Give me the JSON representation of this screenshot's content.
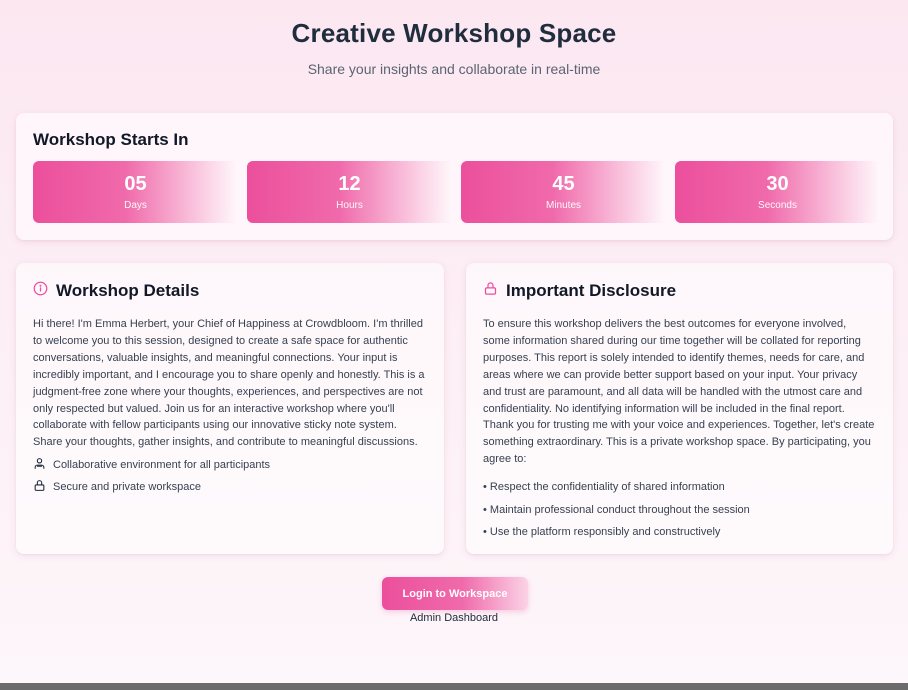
{
  "header": {
    "title": "Creative Workshop Space",
    "subtitle": "Share your insights and collaborate in real-time"
  },
  "countdown": {
    "title": "Workshop Starts In",
    "timers": [
      {
        "value": "05",
        "label": "Days"
      },
      {
        "value": "12",
        "label": "Hours"
      },
      {
        "value": "45",
        "label": "Minutes"
      },
      {
        "value": "30",
        "label": "Seconds"
      }
    ]
  },
  "details": {
    "icon": "info-icon",
    "title": "Workshop Details",
    "body": "Hi there! I'm Emma Herbert, your Chief of Happiness at Crowdbloom. I'm thrilled to welcome you to this session, designed to create a safe space for authentic conversations, valuable insights, and meaningful connections. Your input is incredibly important, and I encourage you to share openly and honestly. This is a judgment-free zone where your thoughts, experiences, and perspectives are not only respected but valued. Join us for an interactive workshop where you'll collaborate with fellow participants using our innovative sticky note system. Share your thoughts, gather insights, and contribute to meaningful discussions.",
    "features": [
      {
        "icon": "users-icon",
        "text": "Collaborative environment for all participants"
      },
      {
        "icon": "lock-icon",
        "text": "Secure and private workspace"
      }
    ]
  },
  "disclosure": {
    "icon": "lock-icon",
    "title": "Important Disclosure",
    "body": "To ensure this workshop delivers the best outcomes for everyone involved, some information shared during our time together will be collated for reporting purposes. This report is solely intended to identify themes, needs for care, and areas where we can provide better support based on your input. Your privacy and trust are paramount, and all data will be handled with the utmost care and confidentiality. No identifying information will be included in the final report. Thank you for trusting me with your voice and experiences. Together, let's create something extraordinary. This is a private workshop space. By participating, you agree to:",
    "bullets": [
      "• Respect the confidentiality of shared information",
      "• Maintain professional conduct throughout the session",
      "• Use the platform responsibly and constructively"
    ]
  },
  "actions": {
    "login_label": "Login to Workspace",
    "admin_label": "Admin Dashboard"
  },
  "colors": {
    "accent": "#ec4f9c",
    "background": "#fce7f1",
    "text": "#1f2937"
  }
}
